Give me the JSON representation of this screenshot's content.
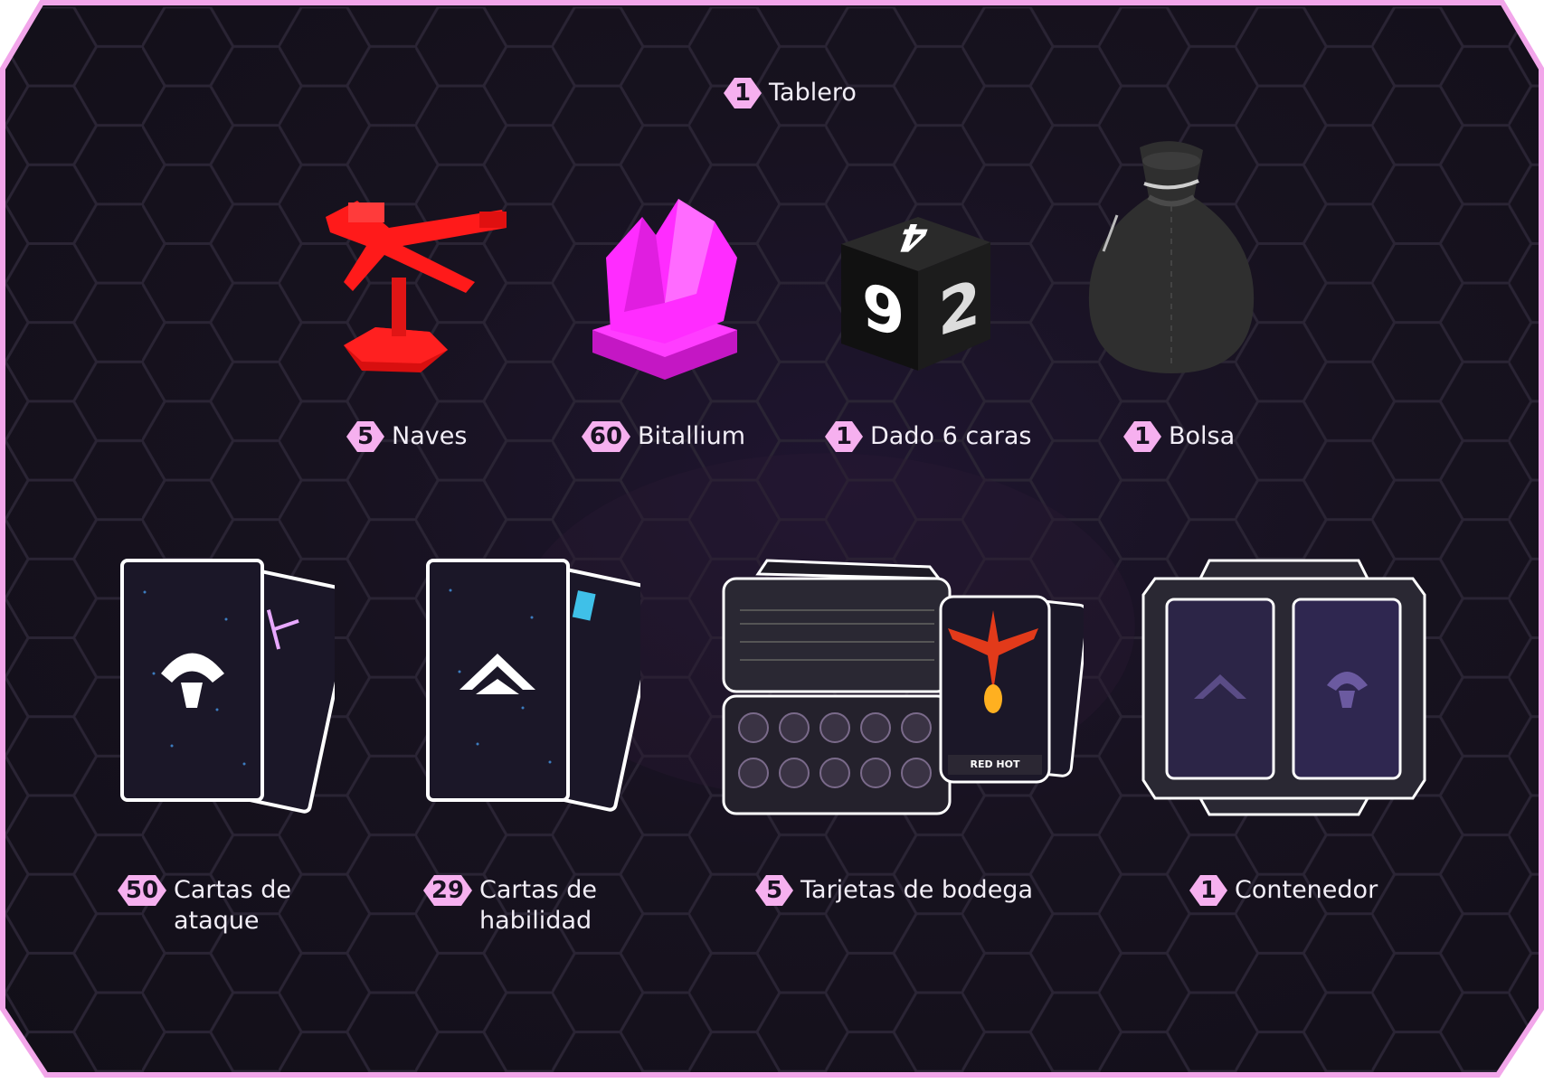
{
  "colors": {
    "frame": "#f2a6ea",
    "badge": "#f6b0ef",
    "background": "#15111c",
    "ship": "#ff1a1a",
    "crystal": "#ff2cff"
  },
  "items": {
    "board": {
      "count": "1",
      "label": "Tablero"
    },
    "ships": {
      "count": "5",
      "label": "Naves",
      "icon": "red-ship-miniature"
    },
    "bitallium": {
      "count": "60",
      "label": "Bitallium",
      "icon": "pink-crystal"
    },
    "die": {
      "count": "1",
      "label": "Dado 6 caras",
      "icon": "six-sided-die",
      "faces": [
        "4",
        "9",
        "2"
      ]
    },
    "bag": {
      "count": "1",
      "label": "Bolsa",
      "icon": "cloth-bag"
    },
    "attack": {
      "count": "50",
      "label": "Cartas de\nataque",
      "icon": "attack-cards"
    },
    "ability": {
      "count": "29",
      "label": "Cartas de\nhabilidad",
      "icon": "ability-cards"
    },
    "cargo": {
      "count": "5",
      "label": "Tarjetas de bodega",
      "icon": "cargo-boards",
      "card_caption": "RED HOT"
    },
    "container": {
      "count": "1",
      "label": "Contenedor",
      "icon": "container-tray"
    }
  }
}
